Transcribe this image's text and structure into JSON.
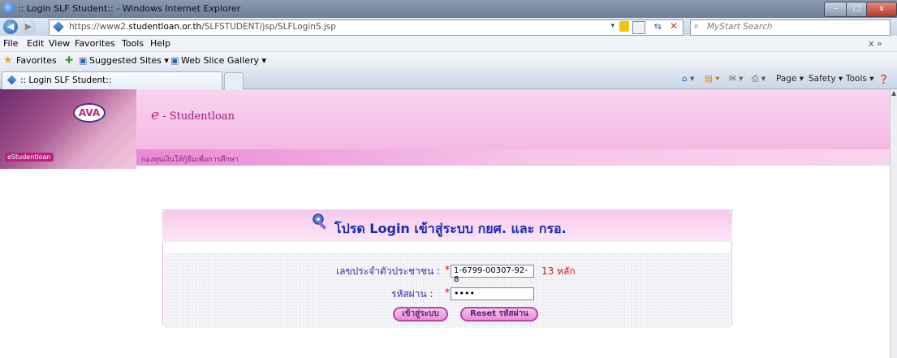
{
  "window": {
    "title": ":: Login SLF Student:: - Windows Internet Explorer",
    "controls": [
      "–",
      "□",
      "x"
    ]
  },
  "address_bar": {
    "url_prefix": "https://www2.",
    "url_domain": "studentloan.or.th",
    "url_path": "/SLFSTUDENT/jsp/SLFLoginS.jsp",
    "search_placeholder": "MyStart Search"
  },
  "menu": [
    "File",
    "Edit",
    "View",
    "Favorites",
    "Tools",
    "Help"
  ],
  "menu_right": "x  »",
  "favorites_bar": {
    "favorites_label": "Favorites",
    "links": [
      "Suggested Sites ▾",
      "Web Slice Gallery ▾"
    ]
  },
  "tab": {
    "title": ":: Login SLF Student::"
  },
  "command_bar": [
    "Page ▾",
    "Safety ▾",
    "Tools ▾"
  ],
  "banner": {
    "brand_prefix": "e",
    "brand_name": "- Studentloan",
    "tagline": "กองทุนเงินให้กู้ยืมเพื่อการศึกษา",
    "photo_caption": "eStudentloan"
  },
  "login": {
    "title": "โปรด Login เข้าสู่ระบบ กยศ. และ กรอ.",
    "id_label": "เลขประจำตัวประชาชน  :",
    "id_value": "1-6799-00307-92-8",
    "id_hint": "13 หลัก",
    "password_label": "รหัสผ่าน  :",
    "password_mask": "••••",
    "required_mark": "*",
    "login_button": "เข้าสู่ระบบ",
    "reset_button": "Reset รหัสผ่าน"
  },
  "colors": {
    "accent": "#1a2bb0",
    "banner_pink": "#f4b6e2",
    "required": "#dd0000",
    "hint": "#c81d1d"
  }
}
